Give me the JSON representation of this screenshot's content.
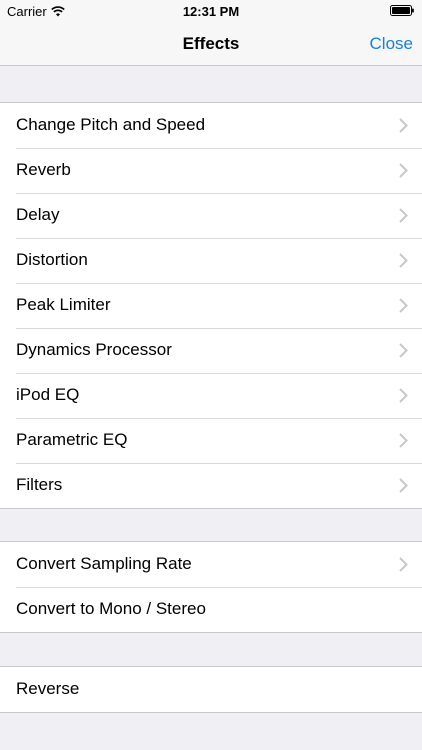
{
  "status_bar": {
    "carrier": "Carrier",
    "time": "12:31 PM"
  },
  "nav": {
    "title": "Effects",
    "close_label": "Close"
  },
  "sections": [
    {
      "items": [
        {
          "label": "Change Pitch and Speed",
          "disclosure": true
        },
        {
          "label": "Reverb",
          "disclosure": true
        },
        {
          "label": "Delay",
          "disclosure": true
        },
        {
          "label": "Distortion",
          "disclosure": true
        },
        {
          "label": "Peak Limiter",
          "disclosure": true
        },
        {
          "label": "Dynamics Processor",
          "disclosure": true
        },
        {
          "label": "iPod EQ",
          "disclosure": true
        },
        {
          "label": "Parametric EQ",
          "disclosure": true
        },
        {
          "label": "Filters",
          "disclosure": true
        }
      ]
    },
    {
      "items": [
        {
          "label": "Convert Sampling Rate",
          "disclosure": true
        },
        {
          "label": "Convert to Mono / Stereo",
          "disclosure": false
        }
      ]
    },
    {
      "items": [
        {
          "label": "Reverse",
          "disclosure": false
        }
      ]
    }
  ],
  "colors": {
    "accent": "#1a7ee0",
    "group_background": "#efeff4",
    "separator": "#c8c7cc",
    "chevron": "#c7c7cc"
  },
  "icons": {
    "wifi": "wifi-icon",
    "battery": "battery-icon",
    "disclosure": "chevron-right-icon"
  }
}
